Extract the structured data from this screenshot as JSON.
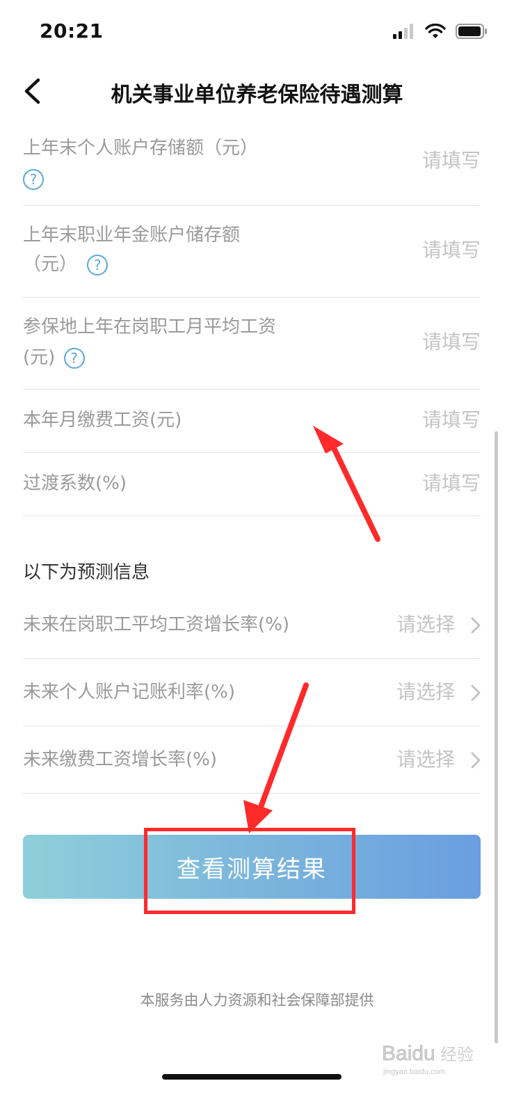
{
  "status_bar": {
    "time": "20:21"
  },
  "nav": {
    "title": "机关事业单位养老保险待遇测算"
  },
  "form_rows": [
    {
      "line1": "上年末个人账户存储额（元）",
      "line2": "",
      "value": "请填写",
      "help": true
    },
    {
      "line1": "上年末职业年金账户储存额",
      "line2": "（元）",
      "value": "请填写",
      "help": true
    },
    {
      "line1": "参保地上年在岗职工月平均工资",
      "line2": "(元)",
      "value": "请填写",
      "help": true
    },
    {
      "line1": "本年月缴费工资(元)",
      "line2": "",
      "value": "请填写",
      "help": false
    },
    {
      "line1": "过渡系数(%)",
      "line2": "",
      "value": "请填写",
      "help": false
    }
  ],
  "forecast": {
    "section_title": "以下为预测信息",
    "rows": [
      {
        "label": "未来在岗职工平均工资增长率(%)",
        "value": "请选择"
      },
      {
        "label": "未来个人账户记账利率(%)",
        "value": "请选择"
      },
      {
        "label": "未来缴费工资增长率(%)",
        "value": "请选择"
      }
    ]
  },
  "cta": {
    "label": "查看测算结果"
  },
  "footer": {
    "text": "本服务由人力资源和社会保障部提供"
  },
  "watermark": {
    "text": "Baidu经验",
    "subtext": "jingyan.baidu.com"
  },
  "colors": {
    "annotation_red": "#ff2a2a",
    "help_blue": "#5aa8dc",
    "cta_start": "#8ecfda",
    "cta_end": "#6a9ee0"
  },
  "icons": [
    "back-chevron-icon",
    "signal-icon",
    "wifi-icon",
    "battery-icon",
    "help-icon",
    "chevron-right-icon",
    "red-arrow-annotation"
  ]
}
